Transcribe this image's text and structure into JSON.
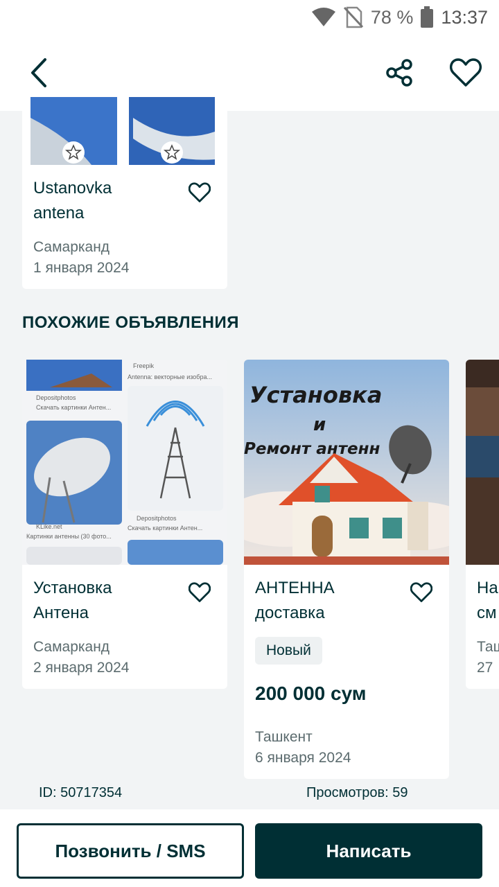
{
  "status_bar": {
    "battery": "78 %",
    "time": "13:37",
    "icons": [
      "wifi-icon",
      "no-sim-icon",
      "battery-icon"
    ]
  },
  "toolbar": {
    "icons": [
      "back-arrow-icon",
      "share-icon",
      "heart-outline-icon"
    ]
  },
  "seller_ads": {
    "items": [
      {
        "title_line1": "Ustanovka",
        "title_line2": "antena",
        "location": "Самарканд",
        "date": "1 января 2024"
      }
    ]
  },
  "similar": {
    "heading": "ПОХОЖИЕ ОБЪЯВЛЕНИЯ",
    "items": [
      {
        "title_line1": "Установка",
        "title_line2": "Антена",
        "location": "Самарканд",
        "date": "2 января 2024",
        "thumb_captions": [
          "Freepik",
          "Antenna: векторные изобра...",
          "Depositphotos",
          "Скачать картинки Антен...",
          "KLike.net",
          "Картинки антенны (30 фото...",
          "Depositphotos",
          "Скачать картинки Антен..."
        ]
      },
      {
        "title_line1": "АНТЕННА",
        "title_line2": "доставка",
        "badge": "Новый",
        "price": "200 000 сум",
        "location": "Ташкент",
        "date": "6 января 2024",
        "thumb_text_line1": "Установка",
        "thumb_text_line2": "и",
        "thumb_text_line3": "Ремонт антенн"
      },
      {
        "title_line1": "На",
        "title_line2": "см",
        "location": "Таш",
        "date": "27 ,"
      }
    ]
  },
  "meta": {
    "id": "ID: 50717354",
    "views": "Просмотров: 59"
  },
  "actions": {
    "call": "Позвонить / SMS",
    "write": "Написать"
  },
  "colors": {
    "brand_dark": "#002f34",
    "background": "#f2f4f5"
  }
}
